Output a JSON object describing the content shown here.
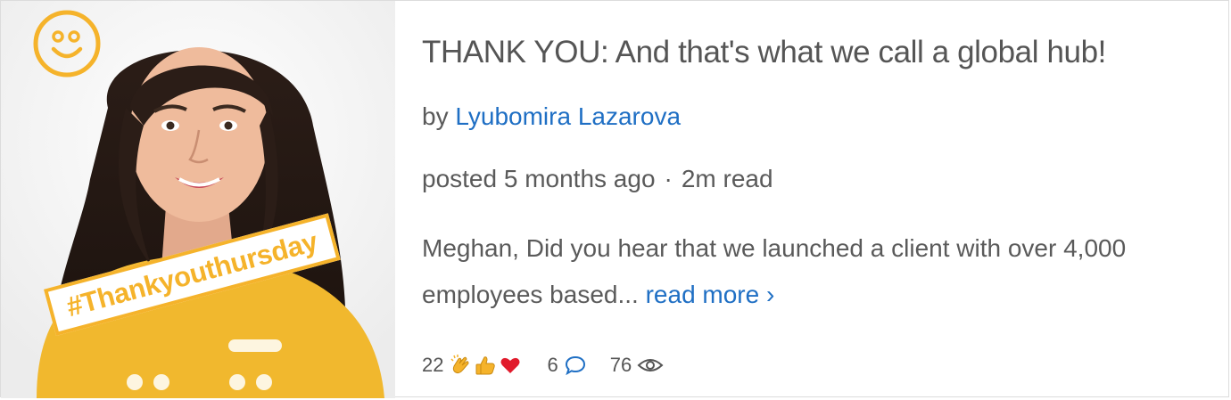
{
  "post": {
    "title": "THANK YOU: And that's what we call a global hub!",
    "by_prefix": "by",
    "author": "Lyubomira Lazarova",
    "posted": "posted 5 months ago",
    "separator": "·",
    "read_time": "2m read",
    "excerpt": "Meghan, Did you hear that we launched a client with over 4,000 employees based...",
    "read_more": "read more ›"
  },
  "thumbnail": {
    "hashtag": "#Thankyouthursday",
    "icon": "smiley-icon",
    "accent": "#f5b32b"
  },
  "stats": {
    "reactions_count": "22",
    "reaction_icons": [
      "clap-icon",
      "thumbs-up-icon",
      "heart-icon"
    ],
    "comments_count": "6",
    "views_count": "76"
  },
  "colors": {
    "link": "#1f6fc4",
    "text": "#555555",
    "accent": "#f5b32b"
  }
}
